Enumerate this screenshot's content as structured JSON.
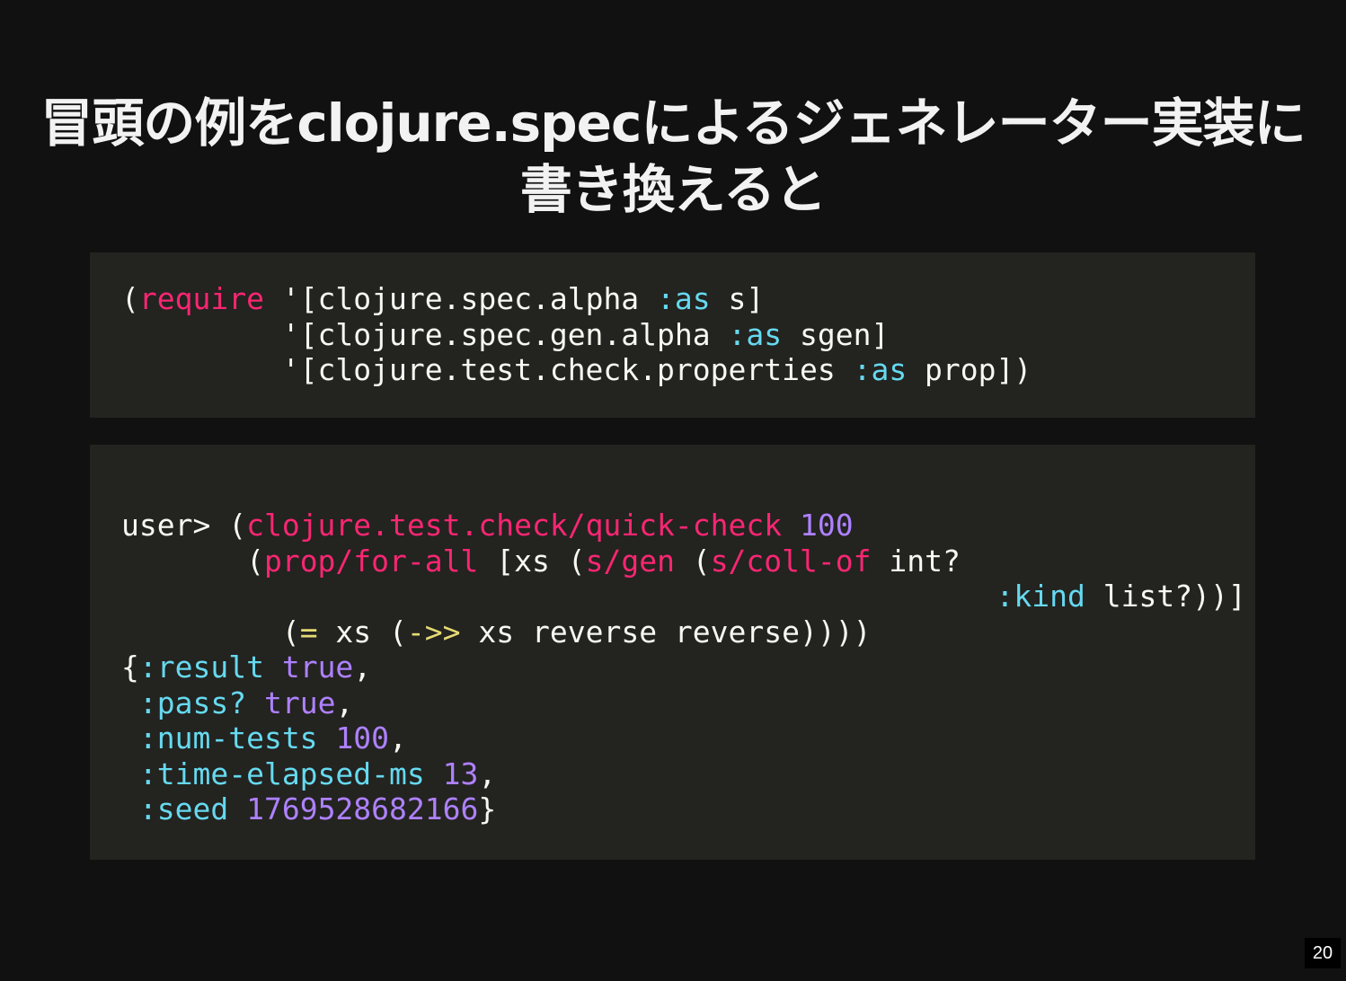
{
  "slide": {
    "title_line1": "冒頭の例をclojure.specによるジェネレーター実装に",
    "title_line2": "書き換えると",
    "page_number": "20"
  },
  "colors": {
    "background": "#111111",
    "code_background": "#232320",
    "text": "#f8f8f2",
    "function": "#f92672",
    "keyword": "#66d9ef",
    "number": "#ae81ff",
    "operator": "#e6db74"
  },
  "code_block_1": {
    "lines": [
      [
        {
          "t": "(",
          "c": "plain"
        },
        {
          "t": "require",
          "c": "fn"
        },
        {
          "t": " '[clojure.spec.alpha ",
          "c": "plain"
        },
        {
          "t": ":as",
          "c": "kw"
        },
        {
          "t": " s]",
          "c": "plain"
        }
      ],
      [
        {
          "t": "         '[clojure.spec.gen.alpha ",
          "c": "plain"
        },
        {
          "t": ":as",
          "c": "kw"
        },
        {
          "t": " sgen]",
          "c": "plain"
        }
      ],
      [
        {
          "t": "         '[clojure.test.check.properties ",
          "c": "plain"
        },
        {
          "t": ":as",
          "c": "kw"
        },
        {
          "t": " prop])",
          "c": "plain"
        }
      ]
    ]
  },
  "code_block_2": {
    "lines": [
      [
        {
          "t": "user> (",
          "c": "plain"
        },
        {
          "t": "clojure.test.check/quick-check",
          "c": "fn"
        },
        {
          "t": " ",
          "c": "plain"
        },
        {
          "t": "100",
          "c": "num"
        }
      ],
      [
        {
          "t": "       (",
          "c": "plain"
        },
        {
          "t": "prop/for-all",
          "c": "fn"
        },
        {
          "t": " [xs (",
          "c": "plain"
        },
        {
          "t": "s/gen",
          "c": "fn"
        },
        {
          "t": " (",
          "c": "plain"
        },
        {
          "t": "s/coll-of",
          "c": "fn"
        },
        {
          "t": " int?",
          "c": "plain"
        }
      ],
      [
        {
          "t": "                                                 ",
          "c": "plain"
        },
        {
          "t": ":kind",
          "c": "kw"
        },
        {
          "t": " list?))]",
          "c": "plain"
        }
      ],
      [
        {
          "t": "         (",
          "c": "plain"
        },
        {
          "t": "=",
          "c": "op"
        },
        {
          "t": " xs (",
          "c": "plain"
        },
        {
          "t": "->>",
          "c": "op"
        },
        {
          "t": " xs reverse reverse))))",
          "c": "plain"
        }
      ],
      [
        {
          "t": "{",
          "c": "plain"
        },
        {
          "t": ":result",
          "c": "kw"
        },
        {
          "t": " ",
          "c": "plain"
        },
        {
          "t": "true",
          "c": "num"
        },
        {
          "t": ",",
          "c": "plain"
        }
      ],
      [
        {
          "t": " ",
          "c": "plain"
        },
        {
          "t": ":pass?",
          "c": "kw"
        },
        {
          "t": " ",
          "c": "plain"
        },
        {
          "t": "true",
          "c": "num"
        },
        {
          "t": ",",
          "c": "plain"
        }
      ],
      [
        {
          "t": " ",
          "c": "plain"
        },
        {
          "t": ":num-tests",
          "c": "kw"
        },
        {
          "t": " ",
          "c": "plain"
        },
        {
          "t": "100",
          "c": "num"
        },
        {
          "t": ",",
          "c": "plain"
        }
      ],
      [
        {
          "t": " ",
          "c": "plain"
        },
        {
          "t": ":time-elapsed-ms",
          "c": "kw"
        },
        {
          "t": " ",
          "c": "plain"
        },
        {
          "t": "13",
          "c": "num"
        },
        {
          "t": ",",
          "c": "plain"
        }
      ],
      [
        {
          "t": " ",
          "c": "plain"
        },
        {
          "t": ":seed",
          "c": "kw"
        },
        {
          "t": " ",
          "c": "plain"
        },
        {
          "t": "1769528682166",
          "c": "num"
        },
        {
          "t": "}",
          "c": "plain"
        }
      ]
    ]
  }
}
